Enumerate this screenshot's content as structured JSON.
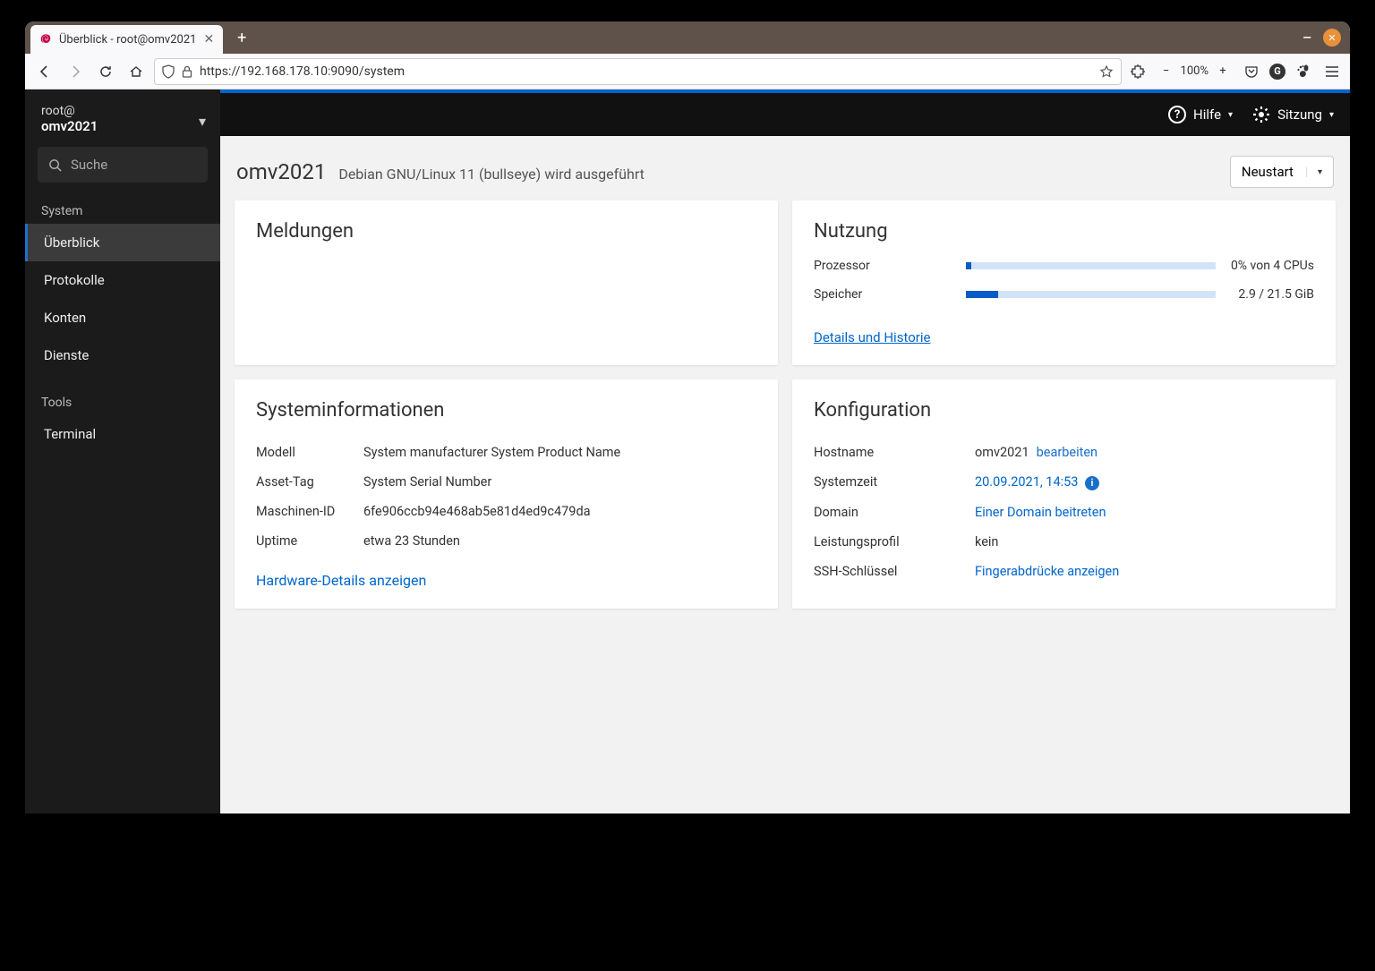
{
  "browser": {
    "tab_title": "Überblick - root@omv2021",
    "url": "https://192.168.178.10:9090/system",
    "zoom": "100%"
  },
  "sidebar": {
    "user": "root@",
    "host": "omv2021",
    "search_placeholder": "Suche",
    "section_system": "System",
    "items": [
      "Überblick",
      "Protokolle",
      "Konten",
      "Dienste"
    ],
    "section_tools": "Tools",
    "tools": [
      "Terminal"
    ]
  },
  "topbar": {
    "help": "Hilfe",
    "session": "Sitzung"
  },
  "page": {
    "title": "omv2021",
    "subtitle": "Debian GNU/Linux 11 (bullseye) wird ausgeführt",
    "restart": "Neustart"
  },
  "meldungen": {
    "title": "Meldungen"
  },
  "nutzung": {
    "title": "Nutzung",
    "cpu_label": "Prozessor",
    "cpu_value": "0% von 4 CPUs",
    "cpu_pct": 2,
    "mem_label": "Speicher",
    "mem_value": "2.9 / 21.5 GiB",
    "mem_pct": 13,
    "details": "Details und Historie"
  },
  "sysinfo": {
    "title": "Systeminformationen",
    "rows": [
      {
        "label": "Modell",
        "value": "System manufacturer System Product Name"
      },
      {
        "label": "Asset-Tag",
        "value": "System Serial Number"
      },
      {
        "label": "Maschinen-ID",
        "value": "6fe906ccb94e468ab5e81d4ed9c479da"
      },
      {
        "label": "Uptime",
        "value": "etwa 23 Stunden"
      }
    ],
    "hw_link": "Hardware-Details anzeigen"
  },
  "config": {
    "title": "Konfiguration",
    "hostname_label": "Hostname",
    "hostname_value": "omv2021",
    "hostname_edit": "bearbeiten",
    "time_label": "Systemzeit",
    "time_value": "20.09.2021, 14:53",
    "domain_label": "Domain",
    "domain_value": "Einer Domain beitreten",
    "perf_label": "Leistungsprofil",
    "perf_value": "kein",
    "ssh_label": "SSH-Schlüssel",
    "ssh_value": "Fingerabdrücke anzeigen"
  }
}
